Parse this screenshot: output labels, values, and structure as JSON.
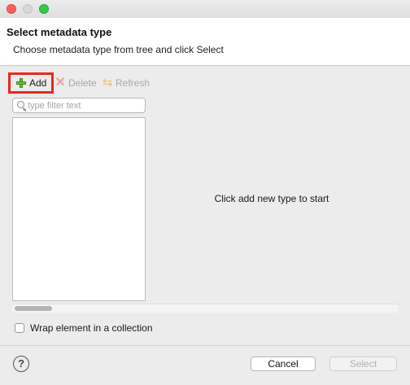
{
  "dialog": {
    "title": "Select metadata type",
    "description": "Choose metadata type from tree and click Select"
  },
  "toolbar": {
    "add_label": "Add",
    "delete_label": "Delete",
    "refresh_label": "Refresh",
    "icons": {
      "add": "plus-icon",
      "delete": "delete-x-icon",
      "refresh": "refresh-icon"
    },
    "highlight_color": "#e8281e"
  },
  "filter": {
    "placeholder": "type filter text",
    "value": "",
    "icon": "search-icon"
  },
  "tree": {
    "items": []
  },
  "details": {
    "empty_message": "Click add new type to start"
  },
  "options": {
    "wrap_label": "Wrap element in a collection",
    "wrap_checked": false
  },
  "footer": {
    "help_glyph": "?",
    "cancel_label": "Cancel",
    "select_label": "Select",
    "select_enabled": false
  }
}
